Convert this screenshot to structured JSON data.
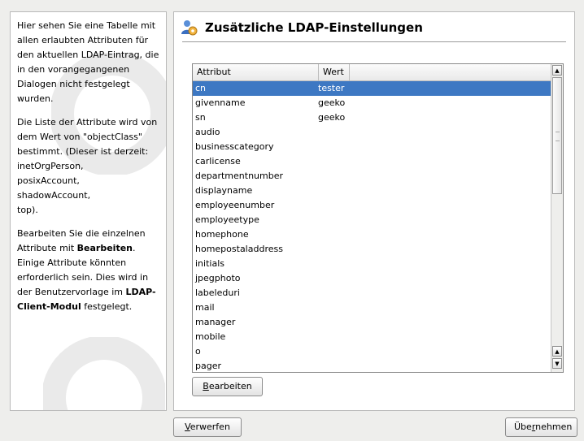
{
  "help": {
    "p1": "Hier sehen Sie eine Tabelle mit allen erlaubten Attributen für den aktuellen LDAP-Eintrag, die in den vorangegangenen Dialogen nicht festgelegt wurden.",
    "p2_lines": [
      "Die Liste der Attribute wird von",
      "dem Wert von \"objectClass\"",
      "bestimmt. (Dieser ist derzeit:",
      "inetOrgPerson,",
      "posixAccount,",
      "shadowAccount,",
      "top)."
    ],
    "p3_before": "Bearbeiten Sie die einzelnen Attribute mit ",
    "p3_bold1": "Bearbeiten",
    "p3_mid": ". Einige Attribute könnten erforderlich sein. Dies wird in der Benutzervorlage im ",
    "p3_bold2": "LDAP-Client-Modul",
    "p3_after": " festgelegt."
  },
  "header": {
    "title": "Zusätzliche LDAP-Einstellungen",
    "icon": "users-settings-icon"
  },
  "table": {
    "columns": [
      "Attribut",
      "Wert"
    ],
    "selected_index": 0,
    "rows": [
      [
        "cn",
        "tester"
      ],
      [
        "givenname",
        "geeko"
      ],
      [
        "sn",
        "geeko"
      ],
      [
        "audio",
        ""
      ],
      [
        "businesscategory",
        ""
      ],
      [
        "carlicense",
        ""
      ],
      [
        "departmentnumber",
        ""
      ],
      [
        "displayname",
        ""
      ],
      [
        "employeenumber",
        ""
      ],
      [
        "employeetype",
        ""
      ],
      [
        "homephone",
        ""
      ],
      [
        "homepostaladdress",
        ""
      ],
      [
        "initials",
        ""
      ],
      [
        "jpegphoto",
        ""
      ],
      [
        "labeleduri",
        ""
      ],
      [
        "mail",
        ""
      ],
      [
        "manager",
        ""
      ],
      [
        "mobile",
        ""
      ],
      [
        "o",
        ""
      ],
      [
        "pager",
        ""
      ]
    ]
  },
  "buttons": {
    "edit_mnemonic": "B",
    "edit_rest": "earbeiten",
    "discard_mnemonic": "V",
    "discard_rest": "erwerfen",
    "accept_pre": "Übe",
    "accept_mnemonic": "r",
    "accept_post": "nehmen"
  },
  "colors": {
    "selection": "#3d78c3",
    "window": "#eeeeec"
  }
}
